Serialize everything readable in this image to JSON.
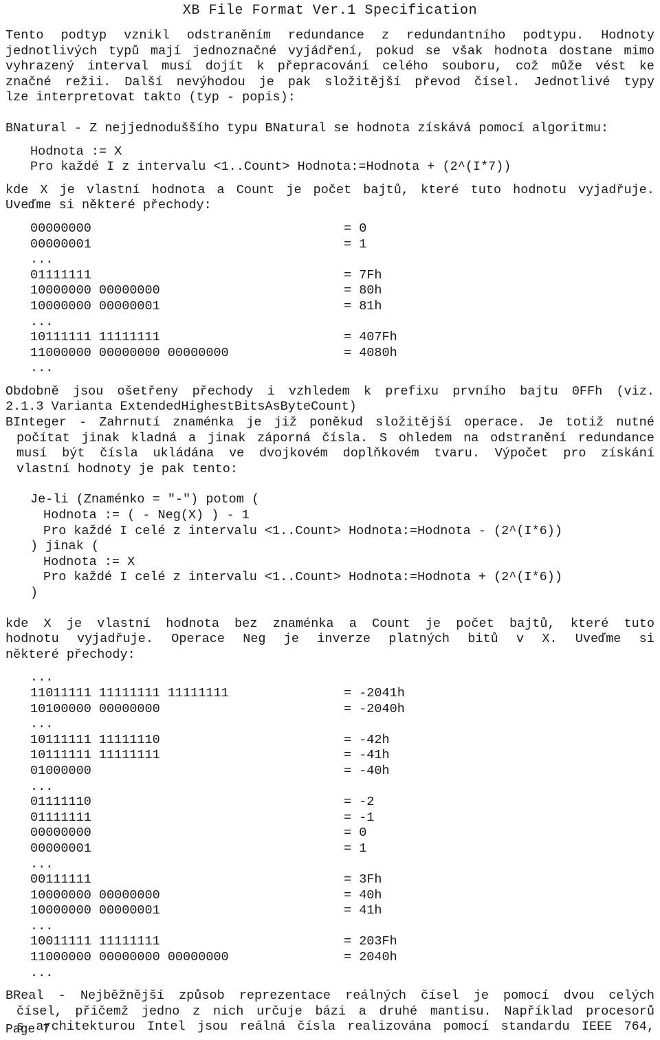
{
  "document": {
    "title": "XB File Format Ver.1 Specification",
    "footer": "Page 7",
    "language": "cs",
    "text_color": "#1a1a1a",
    "background_color": "#ffffff"
  },
  "intro_paragraph": {
    "lines": [
      " Tento  podtyp  vznikl  odstraněním  redundance z redundantního podtypu. Hodnoty",
      "jednotlivých typů mají jednoznačné vyjádření, pokud se však hodnota dostane mimo",
      "vyhrazený  interval  musí  dojít k přepracování celého souboru, což může vést ke",
      "značné  režii.  Další  nevýhodou je pak složitější převod čísel. Jednotlivé typy",
      "lze interpretovat takto (typ - popis):"
    ],
    "justified_line_words": [
      [
        "Tento",
        "podtyp",
        "vznikl",
        "odstraněním",
        "redundance",
        "z",
        "redundantního",
        "podtypu.",
        "Hodnoty"
      ],
      [
        "jednotlivých",
        "typů",
        "mají",
        "jednoznačné",
        "vyjádření,",
        "pokud",
        "se",
        "však",
        "hodnota",
        "dostane",
        "mimo"
      ],
      [
        "vyhrazený",
        "interval",
        "musí",
        "dojít",
        "k",
        "přepracování",
        "celého",
        "souboru,",
        "což",
        "může",
        "vést",
        "ke"
      ],
      [
        "značné",
        "režii.",
        "Další",
        "nevýhodou",
        "je",
        "pak",
        "složitější",
        "převod",
        "čísel.",
        "Jednotlivé",
        "typy"
      ],
      [
        "lze interpretovat takto (typ - popis):"
      ]
    ]
  },
  "bnatural": {
    "heading": "BNatural - Z nejjednoduššího typu BNatural se hodnota získává pomocí algoritmu:",
    "algorithm": [
      "Hodnota := X",
      "Pro každé I z intervalu <1..Count> Hodnota:=Hodnota + (2^(I*7))"
    ],
    "explanation_lines": [
      "kde X je vlastní hodnota a Count je počet bajtů, které tuto hodnotu vyjadřuje.",
      "Uveďme si některé přechody:"
    ],
    "explanation_words": [
      [
        "kde",
        "X",
        "je",
        "vlastní",
        "hodnota",
        "a",
        "Count",
        "je",
        "počet",
        "bajtů,",
        "které",
        "tuto",
        "hodnotu",
        "vyjadřuje."
      ],
      [
        "Uveďme si některé přechody:"
      ]
    ],
    "table": [
      {
        "bits": "00000000",
        "value": "= 0"
      },
      {
        "bits": "00000001",
        "value": "= 1"
      },
      {
        "bits": "...",
        "value": ""
      },
      {
        "bits": "01111111",
        "value": "= 7Fh"
      },
      {
        "bits": "10000000 00000000",
        "value": "= 80h"
      },
      {
        "bits": "10000000 00000001",
        "value": "= 81h"
      },
      {
        "bits": "...",
        "value": ""
      },
      {
        "bits": "10111111 11111111",
        "value": "= 407Fh"
      },
      {
        "bits": "11000000 00000000 00000000",
        "value": "= 4080h"
      },
      {
        "bits": "...",
        "value": ""
      }
    ]
  },
  "note_paragraph": {
    "lines": [
      "Obdobně  jsou  ošetřeny přechody i vzhledem k prefixu prvního bajtu 0FFh (viz.",
      "2.1.3 Varianta ExtendedHighestBitsAsByteCount)"
    ],
    "words": [
      [
        "Obdobně",
        "jsou",
        "ošetřeny",
        "přechody",
        "i",
        "vzhledem",
        "k",
        "prefixu",
        "prvního",
        "bajtu",
        "0FFh",
        "(viz."
      ],
      [
        "2.1.3 Varianta ExtendedHighestBitsAsByteCount)"
      ]
    ]
  },
  "binteger": {
    "intro_lines": [
      "BInteger  - Zahrnutí znaménka je již poněkud složitější operace. Je totiž nutné",
      "počítat jinak kladná a jinak záporná čísla. S ohledem na odstranění redundance",
      "musí  být  čísla  ukládána  ve dvojkovém doplňkovém tvaru. Výpočet pro získání",
      "vlastní hodnoty je pak tento:"
    ],
    "intro_words": [
      [
        "BInteger",
        "-",
        "Zahrnutí",
        "znaménka",
        "je",
        "již",
        "poněkud",
        "složitější",
        "operace.",
        "Je",
        "totiž",
        "nutné"
      ],
      [
        "počítat",
        "jinak",
        "kladná",
        "a",
        "jinak",
        "záporná",
        "čísla.",
        "S",
        "ohledem",
        "na",
        "odstranění",
        "redundance"
      ],
      [
        "musí",
        "být",
        "čísla",
        "ukládána",
        "ve",
        "dvojkovém",
        "doplňkovém",
        "tvaru.",
        "Výpočet",
        "pro",
        "získání"
      ],
      [
        "vlastní hodnoty je pak tento:"
      ]
    ],
    "algorithm": [
      {
        "text": "Je-li (Znaménko = \"-\") potom (",
        "indent": 0
      },
      {
        "text": "Hodnota := ( - Neg(X) ) - 1",
        "indent": 1
      },
      {
        "text": "Pro každé I celé z intervalu <1..Count> Hodnota:=Hodnota - (2^(I*6))",
        "indent": 1
      },
      {
        "text": ") jinak (",
        "indent": 0
      },
      {
        "text": "Hodnota := X",
        "indent": 1
      },
      {
        "text": "Pro každé I celé z intervalu <1..Count> Hodnota:=Hodnota + (2^(I*6))",
        "indent": 1
      },
      {
        "text": ")",
        "indent": 0
      }
    ],
    "explanation_lines": [
      "kde  X  je  vlastní  hodnota  bez  znaménka a Count je počet bajtů, které tuto",
      "hodnotu vyjadřuje. Operace Neg  je  inverze  platných  bitů  v X. Uveďme si",
      "některé přechody:"
    ],
    "explanation_words": [
      [
        "kde",
        "X",
        "je",
        "vlastní",
        "hodnota",
        "bez",
        "znaménka",
        "a",
        "Count",
        "je",
        "počet",
        "bajtů,",
        "které",
        "tuto"
      ],
      [
        "hodnotu",
        "vyjadřuje.",
        "Operace",
        "Neg",
        "je",
        "inverze",
        "platných",
        "bitů",
        "v",
        "X.",
        "Uveďme",
        "si"
      ],
      [
        "některé přechody:"
      ]
    ],
    "table": [
      {
        "bits": "...",
        "value": ""
      },
      {
        "bits": "11011111 11111111 11111111",
        "value": "= -2041h"
      },
      {
        "bits": "10100000 00000000",
        "value": "= -2040h"
      },
      {
        "bits": "...",
        "value": ""
      },
      {
        "bits": "10111111 11111110",
        "value": "= -42h"
      },
      {
        "bits": "10111111 11111111",
        "value": "= -41h"
      },
      {
        "bits": "01000000",
        "value": "= -40h"
      },
      {
        "bits": "...",
        "value": ""
      },
      {
        "bits": "01111110",
        "value": "= -2"
      },
      {
        "bits": "01111111",
        "value": "= -1"
      },
      {
        "bits": "00000000",
        "value": "= 0"
      },
      {
        "bits": "00000001",
        "value": "= 1"
      },
      {
        "bits": "...",
        "value": ""
      },
      {
        "bits": "00111111",
        "value": "= 3Fh"
      },
      {
        "bits": "10000000 00000000",
        "value": "= 40h"
      },
      {
        "bits": "10000000 00000001",
        "value": "= 41h"
      },
      {
        "bits": "...",
        "value": ""
      },
      {
        "bits": "10011111 11111111",
        "value": "= 203Fh"
      },
      {
        "bits": "11000000 00000000 00000000",
        "value": "= 2040h"
      },
      {
        "bits": "...",
        "value": ""
      }
    ]
  },
  "breal": {
    "lines": [
      "BReal  -  Nejběžnější  způsob reprezentace reálných čísel je pomocí dvou celých",
      "čísel,  přičemž  jedno z nich určuje bázi a druhé mantisu. Například procesorů",
      "s architekturou Intel jsou reálná čísla realizována pomocí standardu IEEE 764,"
    ],
    "words": [
      [
        "BReal",
        "-",
        "Nejběžnější",
        "způsob",
        "reprezentace",
        "reálných",
        "čísel",
        "je",
        "pomocí",
        "dvou",
        "celých"
      ],
      [
        "čísel,",
        "přičemž",
        "jedno",
        "z",
        "nich",
        "určuje",
        "bázi",
        "a",
        "druhé",
        "mantisu.",
        "Například",
        "procesorů"
      ],
      [
        "s",
        "architekturou",
        "Intel",
        "jsou",
        "reálná",
        "čísla",
        "realizována",
        "pomocí",
        "standardu",
        "IEEE",
        "764,"
      ]
    ]
  }
}
